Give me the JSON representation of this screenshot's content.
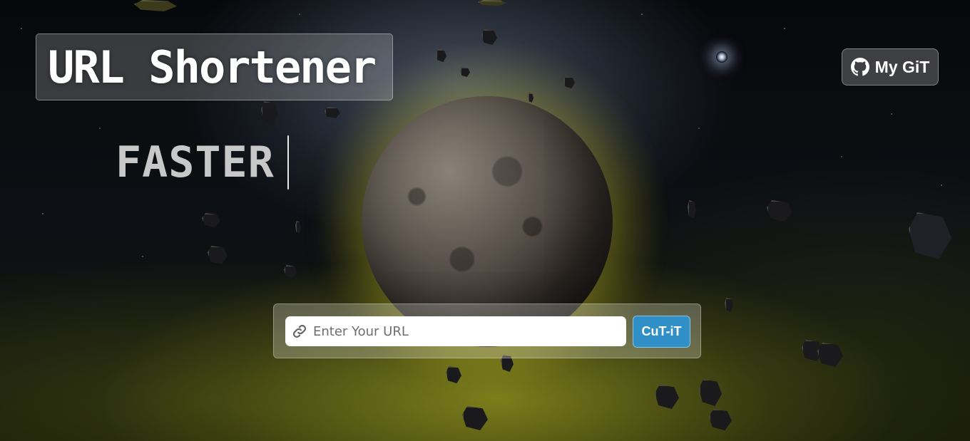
{
  "header": {
    "title": "URL Shortener",
    "typed_word": "FASTER"
  },
  "nav": {
    "git_label": "My GiT",
    "git_icon": "github-icon"
  },
  "form": {
    "placeholder": "Enter Your URL",
    "value": "",
    "input_icon": "link-icon",
    "submit_label": "CuT-iT"
  },
  "colors": {
    "button_accent": "#2f8fc6",
    "glow": "#e6dc32"
  }
}
